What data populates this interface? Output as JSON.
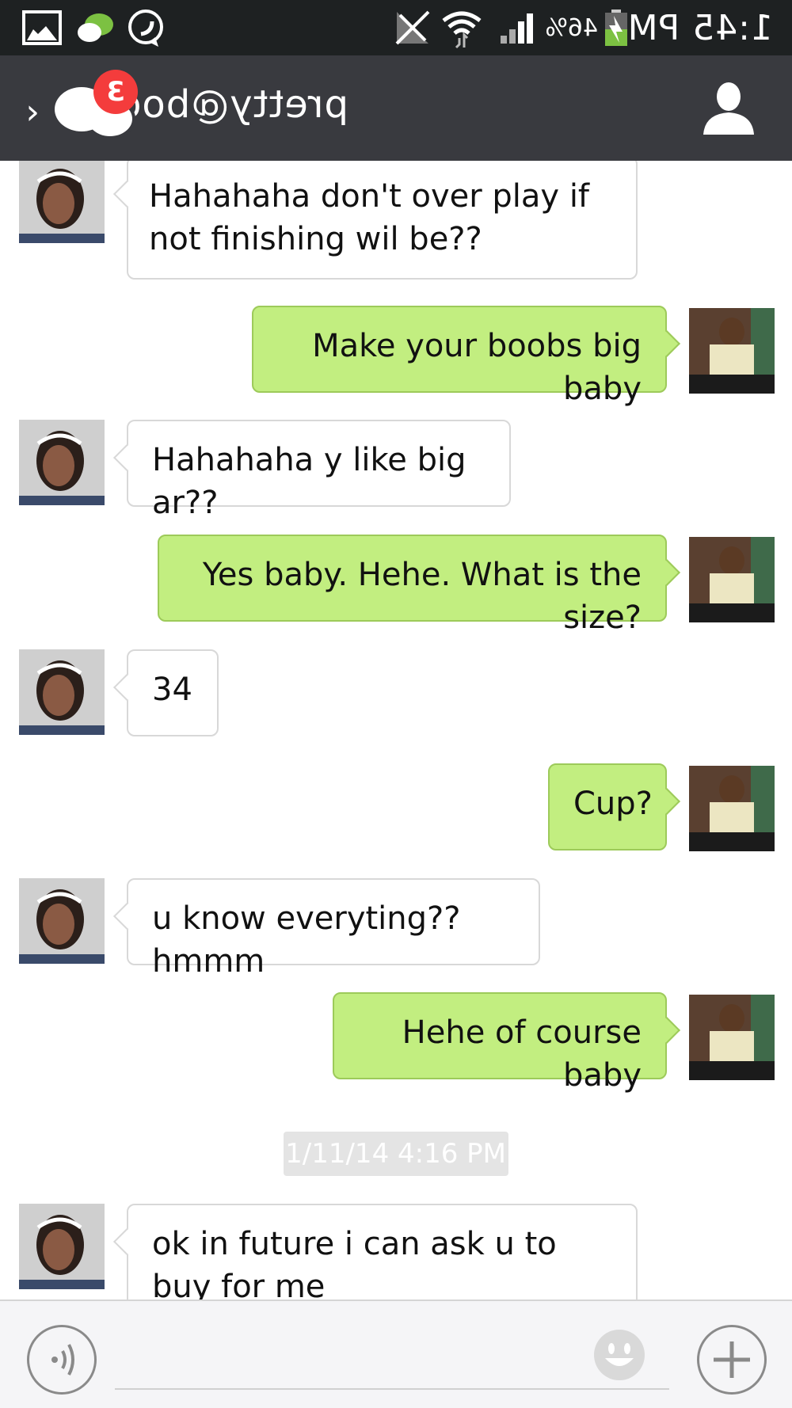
{
  "status_bar": {
    "time": "1:45 PM",
    "battery_percent": "46%",
    "icons": [
      "battery-charging-icon",
      "signal-icon",
      "wifi-icon",
      "no-sim-icon",
      "whatsapp-icon",
      "wechat-icon",
      "gallery-icon"
    ]
  },
  "header": {
    "title": "pretty@boo",
    "unread_badge": "3",
    "icons": [
      "back-chevron-icon",
      "wechat-icon",
      "profile-icon"
    ]
  },
  "messages": [
    {
      "from": "them",
      "text": "Hahahaha don't over play if not finishing wil be??"
    },
    {
      "from": "me",
      "text": "Make your boobs big baby"
    },
    {
      "from": "them",
      "text": "Hahahaha y like big ar??"
    },
    {
      "from": "me",
      "text": "Yes baby. Hehe. What is the size?"
    },
    {
      "from": "them",
      "text": "34"
    },
    {
      "from": "me",
      "text": "Cup?"
    },
    {
      "from": "them",
      "text": "u know everyting??hmmm"
    },
    {
      "from": "me",
      "text": "Hehe of course baby"
    }
  ],
  "timestamp": "1/11/14 4:16 PM",
  "last_message": {
    "from": "them",
    "text": "ok in future i can ask u to buy for me"
  },
  "input_bar": {
    "icons": [
      "plus-icon",
      "emoji-icon",
      "voice-icon"
    ],
    "placeholder": ""
  },
  "colors": {
    "status_bar_bg": "#1e2122",
    "header_bg": "#393a3f",
    "my_bubble": "#c2ee80",
    "their_bubble": "#ffffff",
    "badge": "#f43c3c"
  }
}
